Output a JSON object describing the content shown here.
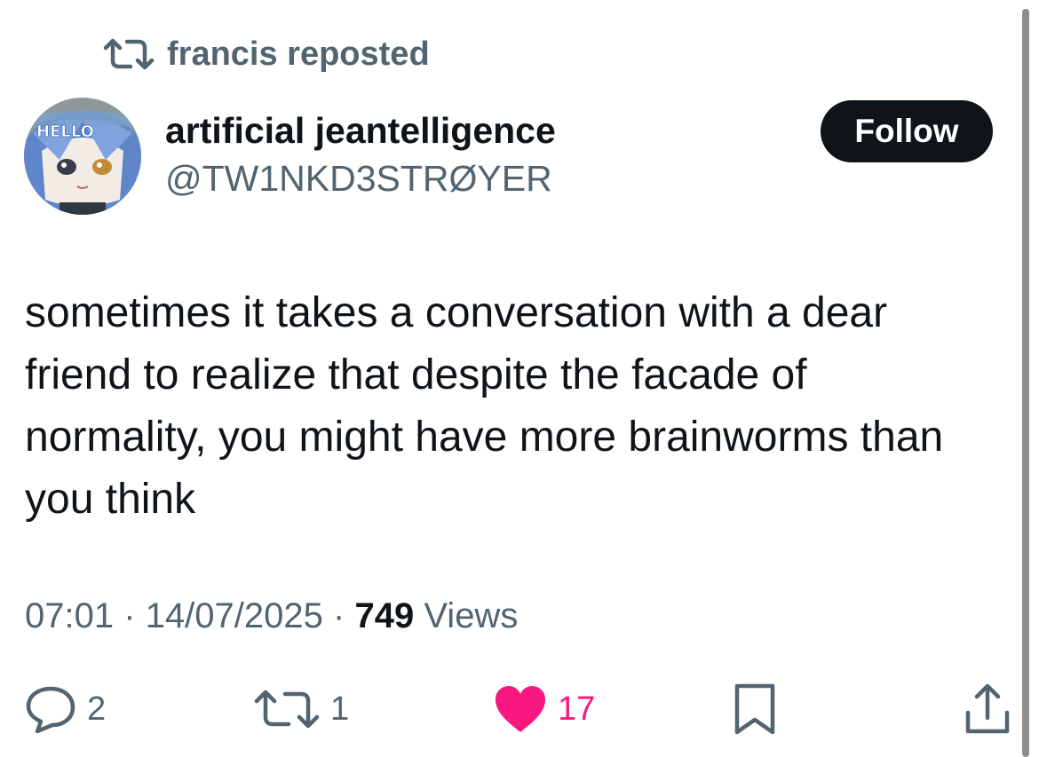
{
  "reposted_by": "francis reposted",
  "author": {
    "display_name": "artificial jeantelligence",
    "handle": "@TW1NKD3STRØYER",
    "avatar_text": "HELLO"
  },
  "follow_label": "Follow",
  "tweet": {
    "lines": [
      "sometimes it takes a conversation with a dear",
      "friend to realize that despite the facade of",
      "normality, you might have more brainworms than",
      "you think"
    ]
  },
  "meta": {
    "time": "07:01",
    "date": "14/07/2025",
    "views_count": "749",
    "views_label": "Views",
    "separator": "·"
  },
  "actions": {
    "replies": "2",
    "reposts": "1",
    "likes": "17"
  },
  "colors": {
    "text_primary": "#0f1419",
    "text_secondary": "#536471",
    "like_pink": "#f91880",
    "follow_bg": "#0f1419"
  },
  "icons": {
    "repost": "repost-icon",
    "reply": "reply-icon",
    "like": "heart-icon",
    "bookmark": "bookmark-icon",
    "share": "share-icon"
  }
}
